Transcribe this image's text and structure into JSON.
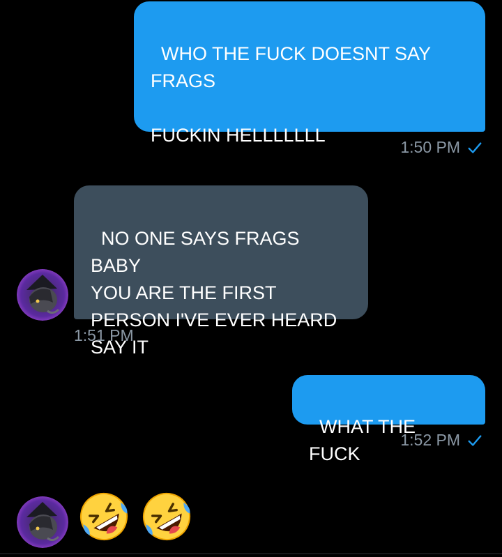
{
  "messages": [
    {
      "direction": "outgoing",
      "text": "WHO THE FUCK DOESNT SAY\nFRAGS\n\nFUCKIN HELLLLLLL",
      "time": "1:50 PM",
      "status_icon": "read-check-icon"
    },
    {
      "direction": "incoming",
      "text": "NO ONE SAYS FRAGS BABY\nYOU ARE THE FIRST\nPERSON I'VE EVER HEARD\nSAY IT",
      "time": "1:51 PM"
    },
    {
      "direction": "outgoing",
      "text": "WHAT THE FUCK",
      "time": "1:52 PM",
      "status_icon": "read-check-icon"
    },
    {
      "direction": "incoming",
      "emoji": [
        "rolling-on-floor-laughing-emoji",
        "rolling-on-floor-laughing-emoji"
      ]
    }
  ],
  "colors": {
    "background": "#000000",
    "outgoing_bubble": "#1d9bf0",
    "incoming_bubble": "#3d4e5c",
    "meta_text": "#8b98a5",
    "check": "#1d9bf0"
  }
}
